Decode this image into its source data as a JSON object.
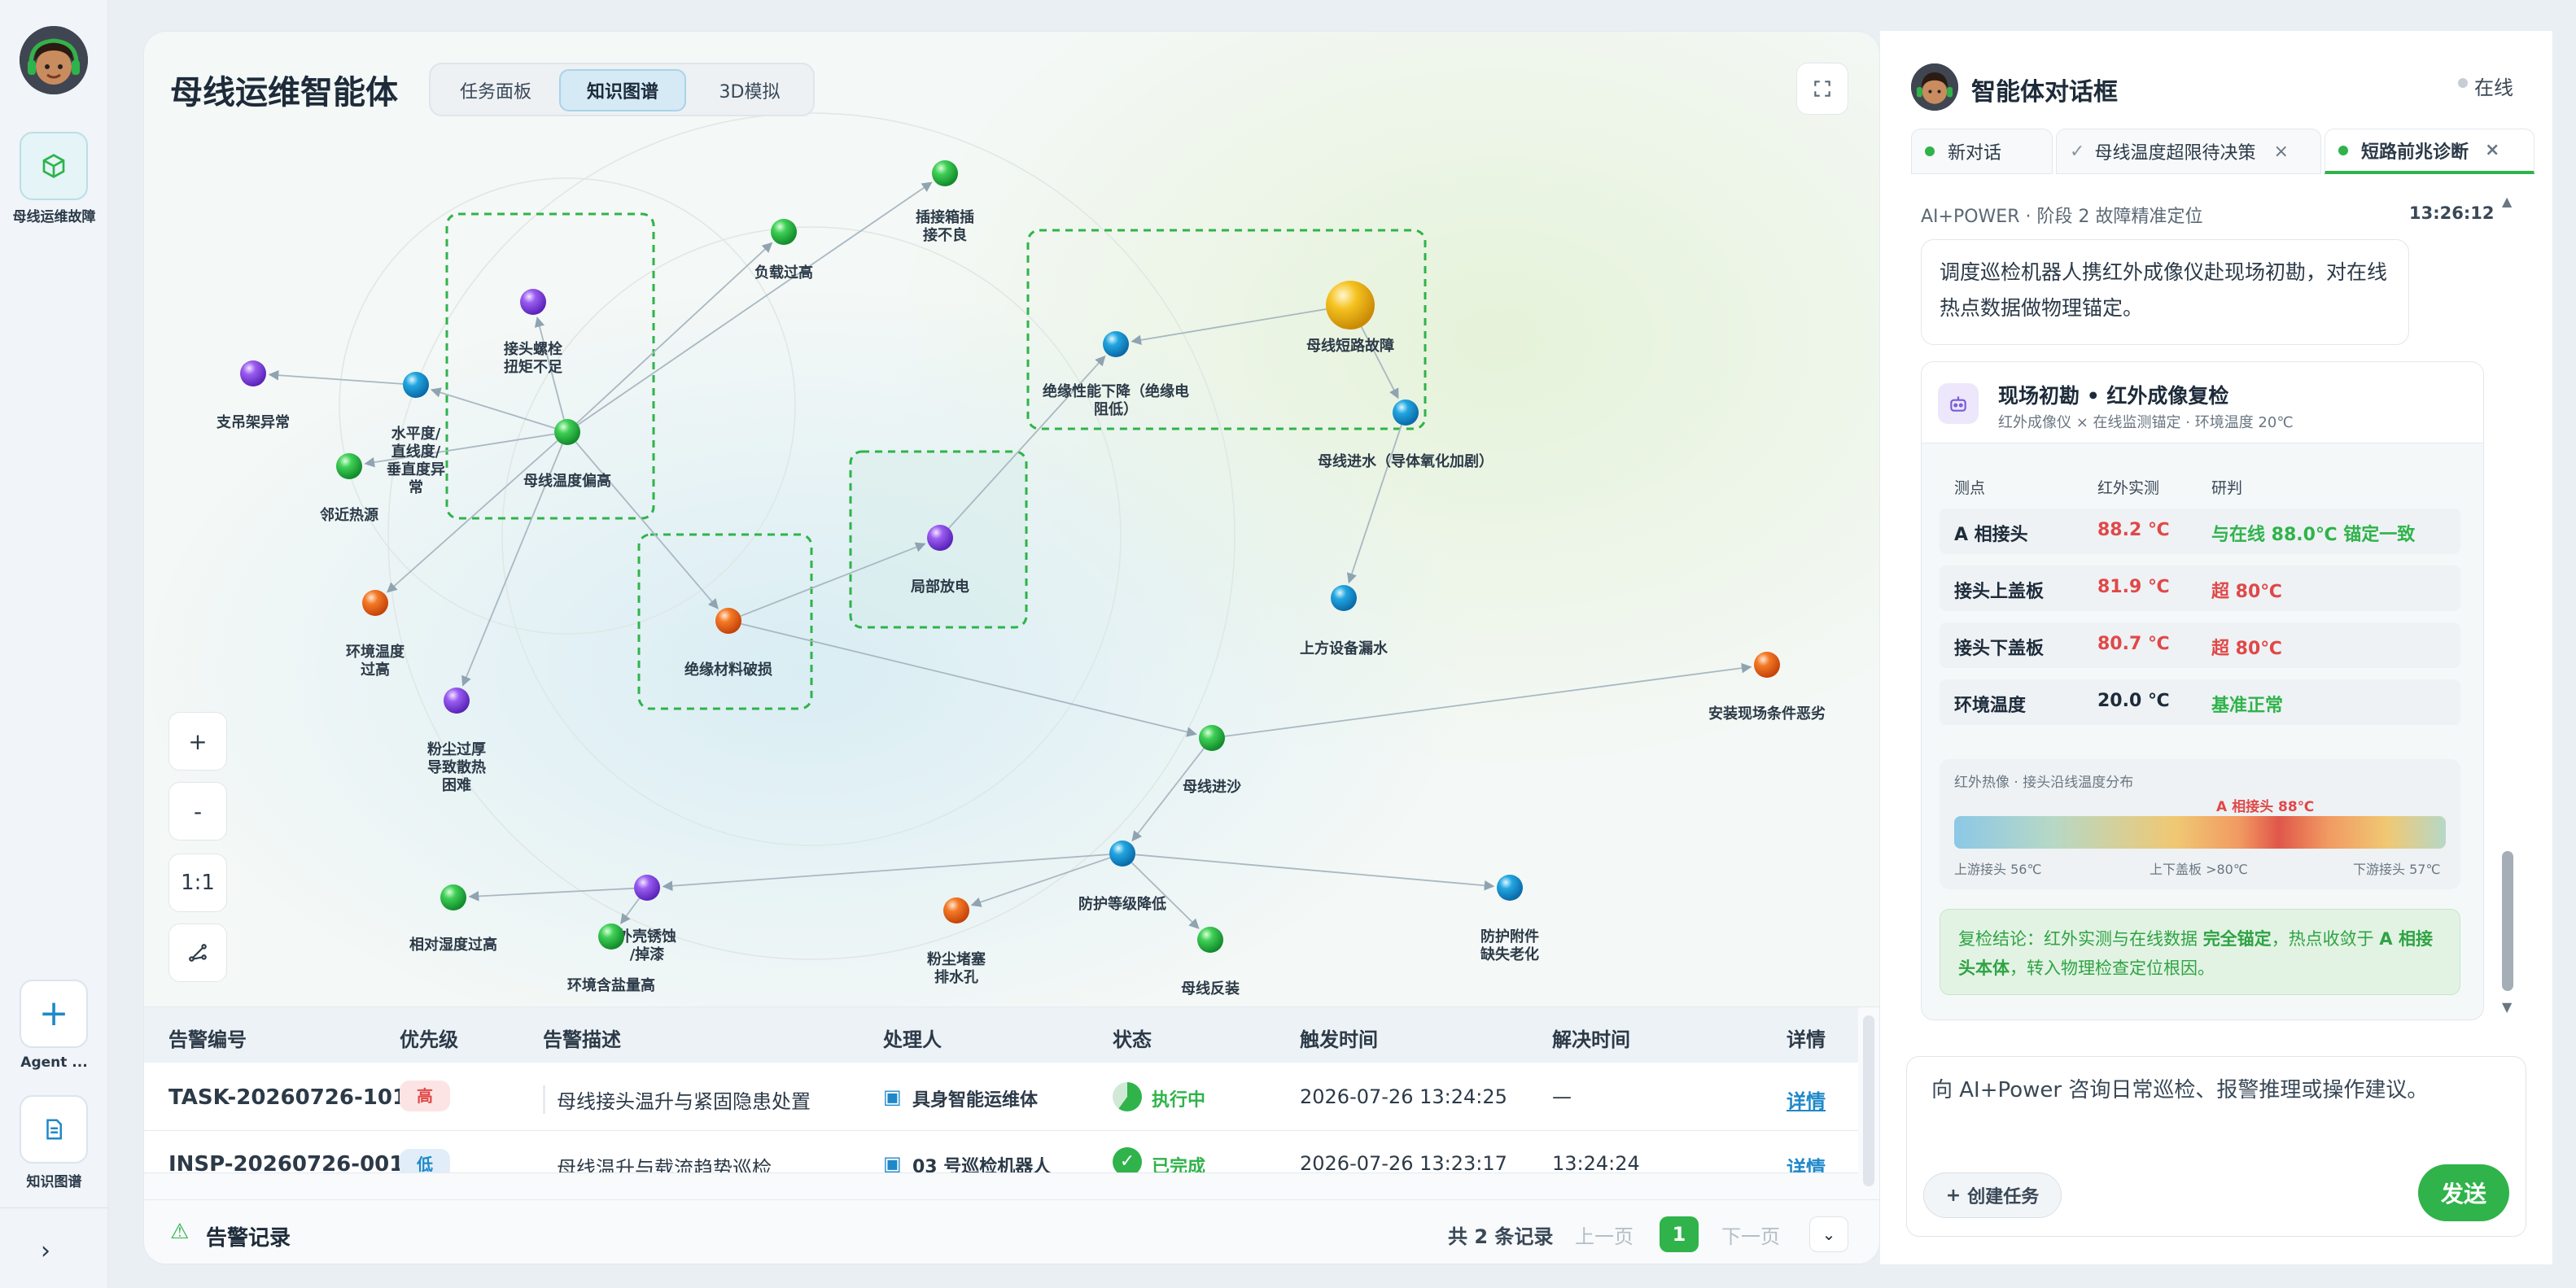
{
  "rail": {
    "nav_fault": "母线运维故障",
    "agent": "Agent ...",
    "knowledge": "知识图谱"
  },
  "main": {
    "title": "母线运维智能体",
    "tabs": [
      "任务面板",
      "知识图谱",
      "3D模拟"
    ],
    "active_tab": "知识图谱"
  },
  "graph": {
    "nodes": [
      {
        "id": "n1",
        "label": [
          "插接箱插",
          "接不良"
        ],
        "color": "green"
      },
      {
        "id": "n2",
        "label": [
          "负载过高"
        ],
        "color": "green"
      },
      {
        "id": "n3",
        "label": [
          "接头螺栓",
          "扭矩不足"
        ],
        "color": "purple"
      },
      {
        "id": "n4",
        "label": [
          "支吊架异常"
        ],
        "color": "purple"
      },
      {
        "id": "n5",
        "label": [
          "水平度/",
          "直线度/",
          "垂直度异",
          "常"
        ],
        "color": "blue"
      },
      {
        "id": "n6",
        "label": [
          "母线温度偏高"
        ],
        "color": "green"
      },
      {
        "id": "n7",
        "label": [
          "邻近热源"
        ],
        "color": "green"
      },
      {
        "id": "n8",
        "label": [
          "环境温度",
          "过高"
        ],
        "color": "orange"
      },
      {
        "id": "n9",
        "label": [
          "粉尘过厚",
          "导致散热",
          "困难"
        ],
        "color": "purple"
      },
      {
        "id": "n10",
        "label": [
          "绝缘性能下降（绝缘电",
          "阻低）"
        ],
        "color": "blue"
      },
      {
        "id": "n11",
        "label": [
          "母线短路故障"
        ],
        "color": "gold"
      },
      {
        "id": "n12",
        "label": [
          "母线进水（导体氧化加剧）"
        ],
        "color": "blue"
      },
      {
        "id": "n13",
        "label": [
          "局部放电"
        ],
        "color": "purple"
      },
      {
        "id": "n14",
        "label": [
          "绝缘材料破损"
        ],
        "color": "orange"
      },
      {
        "id": "n15",
        "label": [
          "上方设备漏水"
        ],
        "color": "blue"
      },
      {
        "id": "n16",
        "label": [
          "安装现场条件恶劣"
        ],
        "color": "orange"
      },
      {
        "id": "n17",
        "label": [
          "母线进沙"
        ],
        "color": "green"
      },
      {
        "id": "n18",
        "label": [
          "防护等级降低"
        ],
        "color": "blue"
      },
      {
        "id": "n19",
        "label": [
          "相对湿度过高"
        ],
        "color": "green"
      },
      {
        "id": "n20",
        "label": [
          "外壳锈蚀",
          "/掉漆"
        ],
        "color": "purple"
      },
      {
        "id": "n21",
        "label": [
          "环境含盐量高"
        ],
        "color": "green"
      },
      {
        "id": "n22",
        "label": [
          "粉尘堵塞",
          "排水孔"
        ],
        "color": "orange"
      },
      {
        "id": "n23",
        "label": [
          "母线反装"
        ],
        "color": "green"
      },
      {
        "id": "n24",
        "label": [
          "防护附件",
          "缺失老化"
        ],
        "color": "blue"
      }
    ],
    "zoom": {
      "in": "+",
      "out": "-",
      "reset": "1:1"
    }
  },
  "table": {
    "headers": [
      "告警编号",
      "优先级",
      "告警描述",
      "处理人",
      "状态",
      "触发时间",
      "解决时间",
      "详情"
    ],
    "rows": [
      {
        "id": "TASK-20260726-101",
        "priority": "高",
        "desc": "母线接头温升与紧固隐患处置",
        "handler": "具身智能运维体",
        "status": "执行中",
        "trigger": "2026-07-26 13:24:25",
        "resolve": "—",
        "detail": "详情"
      },
      {
        "id": "INSP-20260726-001",
        "priority": "低",
        "desc": "母线温升与载流趋势巡检",
        "handler": "03 号巡检机器人",
        "status": "已完成",
        "trigger": "2026-07-26 13:23:17",
        "resolve": "13:24:24",
        "detail": "详情"
      }
    ],
    "footer": {
      "title": "告警记录",
      "total": "共 2 条记录",
      "prev": "上一页",
      "page": "1",
      "next": "下一页"
    }
  },
  "chat": {
    "title": "智能体对话框",
    "status": "在线",
    "tabs": [
      "新对话",
      "母线温度超限待决策",
      "短路前兆诊断"
    ],
    "meta": "AI+POWER · 阶段 2 故障精准定位",
    "time": "13:26:12",
    "message": "调度巡检机器人携红外成像仪赴现场初勘，对在线热点数据做物理锚定。",
    "card": {
      "title": "现场初勘 • 红外成像复检",
      "subtitle": "红外成像仪 × 在线监测锚定 · 环境温度 20℃",
      "cols": [
        "测点",
        "红外实测",
        "研判"
      ],
      "rows": [
        {
          "point": "A 相接头",
          "value": "88.2 ℃",
          "judge": "与在线 88.0℃ 锚定一致"
        },
        {
          "point": "接头上盖板",
          "value": "81.9 ℃",
          "judge": "超 80℃"
        },
        {
          "point": "接头下盖板",
          "value": "80.7 ℃",
          "judge": "超 80℃"
        },
        {
          "point": "环境温度",
          "value": "20.0 ℃",
          "judge": "基准正常"
        }
      ],
      "thermal": {
        "title": "红外热像 · 接头沿线温度分布",
        "peak": "A 相接头 88℃",
        "left": "上游接头 56℃",
        "mid": "上下盖板 >80℃",
        "right": "下游接头 57℃"
      },
      "conclusion_pre": "复检结论：红外实测与在线数据 ",
      "conclusion_b1": "完全锚定",
      "conclusion_mid": "，热点收敛于 ",
      "conclusion_b2": "A 相接头本体",
      "conclusion_post": "，转入物理检查定位根因。"
    },
    "input_placeholder": "向 AI+Power 咨询日常巡检、报警推理或操作建议。",
    "create_task": "创建任务",
    "send": "发送"
  },
  "colors": {
    "accent_green": "#2fb34a",
    "accent_blue": "#1e88c9",
    "danger": "#e04848"
  }
}
